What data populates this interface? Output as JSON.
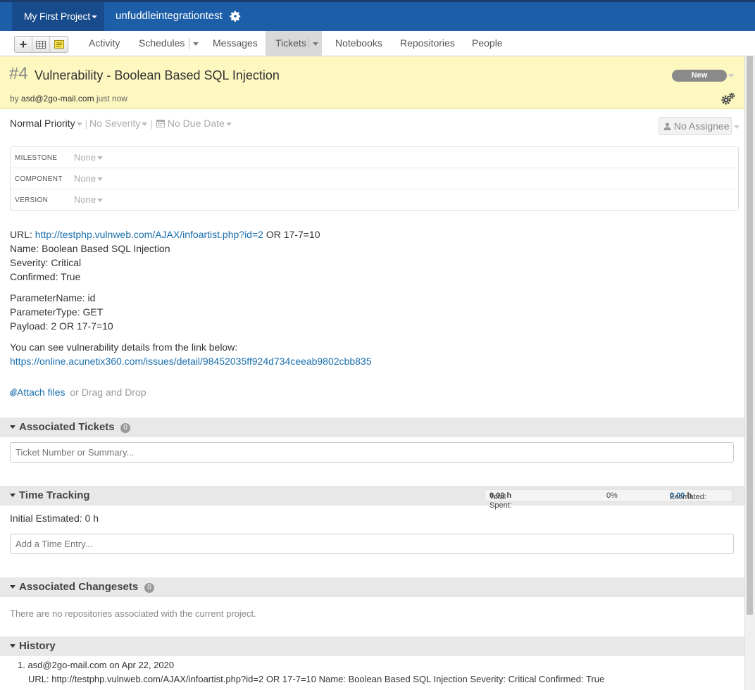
{
  "topbar": {
    "project_label": "My First Project",
    "account_name": "unfuddleintegrationtest"
  },
  "nav": {
    "tabs": [
      "Activity",
      "Schedules",
      "Messages",
      "Tickets",
      "Notebooks",
      "Repositories",
      "People"
    ],
    "active_tab": "Tickets"
  },
  "ticket": {
    "number": "#4",
    "title": "Vulnerability - Boolean Based SQL Injection",
    "by_prefix": "by",
    "author": "asd@2go-mail.com",
    "when": "just now",
    "status": "New"
  },
  "meta": {
    "priority": "Normal Priority",
    "severity": "No Severity",
    "due_date": "No Due Date",
    "assignee": "No Assignee"
  },
  "properties": [
    {
      "label": "MILESTONE",
      "value": "None"
    },
    {
      "label": "COMPONENT",
      "value": "None"
    },
    {
      "label": "VERSION",
      "value": "None"
    }
  ],
  "description": {
    "url_prefix": "URL:",
    "url_link": "http://testphp.vulnweb.com/AJAX/infoartist.php?id=2",
    "url_suffix": "OR 17-7=10",
    "name": "Name: Boolean Based SQL Injection",
    "severity": "Severity: Critical",
    "confirmed": "Confirmed: True",
    "param_name": "ParameterName: id",
    "param_type": "ParameterType: GET",
    "payload": "Payload: 2 OR 17-7=10",
    "details_intro": "You can see vulnerability details from the link below:",
    "details_link": "https://online.acunetix360.com/issues/detail/98452035ff924d734ceeab9802cbb835"
  },
  "attach": {
    "link": "Attach files",
    "or_text": "or Drag and Drop"
  },
  "associated_tickets": {
    "title": "Associated Tickets",
    "count": "0",
    "placeholder": "Ticket Number or Summary..."
  },
  "time_tracking": {
    "title": "Time Tracking",
    "total_label": "Total Spent:",
    "total_value": "0.00 h",
    "percent": "0%",
    "estimated_label": "Estimated:",
    "estimated_value": "0.00",
    "estimated_unit": "h",
    "initial": "Initial Estimated: 0 h",
    "placeholder": "Add a Time Entry..."
  },
  "changesets": {
    "title": "Associated Changesets",
    "count": "0",
    "empty_text": "There are no repositories associated with the current project."
  },
  "history": {
    "title": "History",
    "entry_header": "1. asd@2go-mail.com on Apr 22, 2020",
    "entry_body": "URL: http://testphp.vulnweb.com/AJAX/infoartist.php?id=2 OR 17-7=10 Name: Boolean Based SQL Injection Severity: Critical Confirmed: True"
  }
}
